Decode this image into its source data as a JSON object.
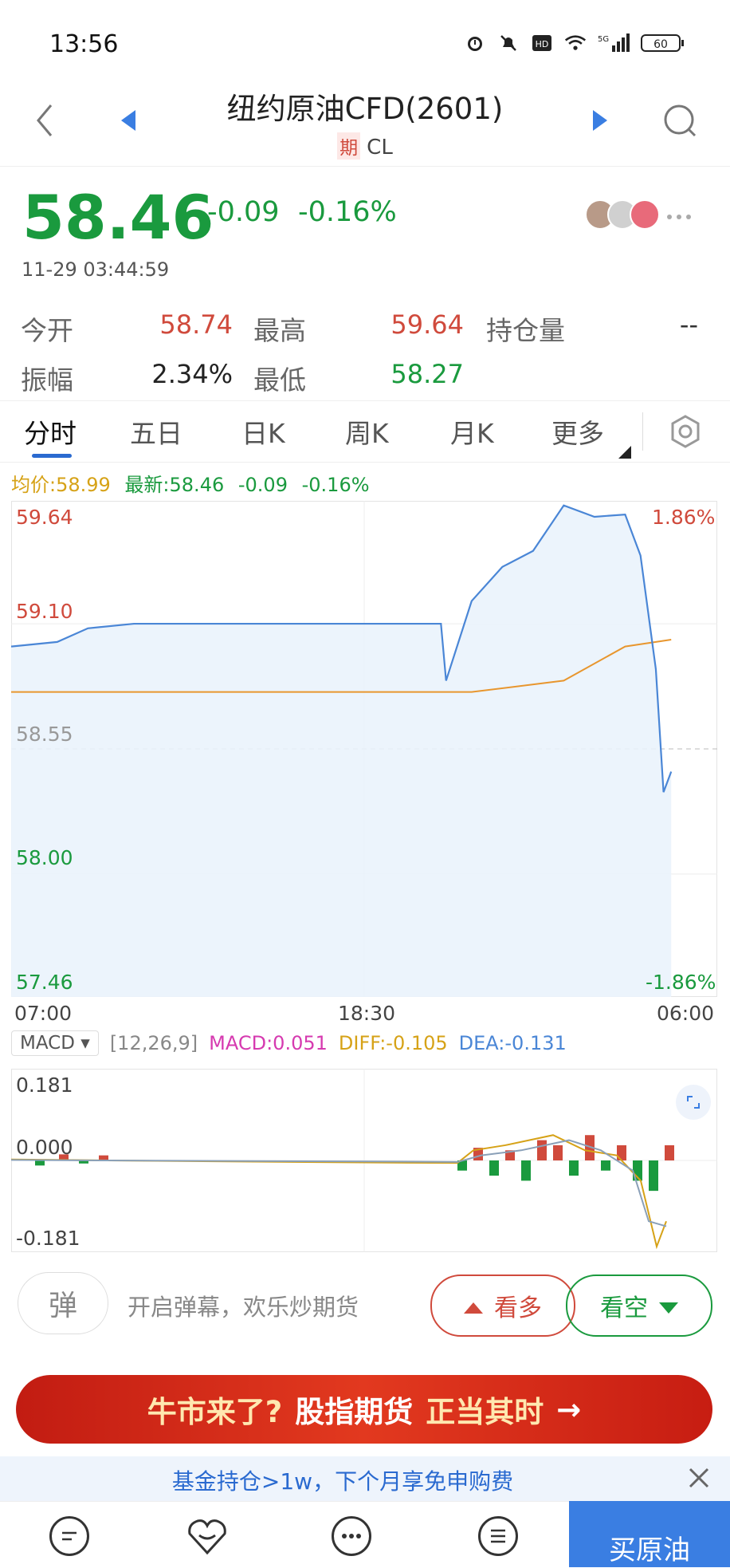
{
  "status": {
    "time": "13:56",
    "battery": "60",
    "signal": "5G"
  },
  "header": {
    "title": "纽约原油CFD(2601)",
    "badge": "期",
    "code": "CL"
  },
  "quote": {
    "price": "58.46",
    "change": "-0.09",
    "change_pct": "-0.16%",
    "timestamp": "11-29 03:44:59"
  },
  "stats": {
    "open_label": "今开",
    "open_value": "58.74",
    "high_label": "最高",
    "high_value": "59.64",
    "oi_label": "持仓量",
    "oi_value": "--",
    "amp_label": "振幅",
    "amp_value": "2.34%",
    "low_label": "最低",
    "low_value": "58.27"
  },
  "tabs": [
    "分时",
    "五日",
    "日K",
    "周K",
    "月K",
    "更多"
  ],
  "legend": {
    "avg": "均价:58.99",
    "latest": "最新:58.46",
    "chg": "-0.09",
    "pct": "-0.16%"
  },
  "chart_data": [
    {
      "type": "line",
      "series": [
        {
          "name": "均价",
          "color": "#e8962e",
          "x": [
            "07:00",
            "11:00",
            "15:00",
            "18:30",
            "22:00",
            "01:00",
            "03:00",
            "04:30"
          ],
          "values": [
            58.8,
            58.8,
            58.8,
            58.8,
            58.8,
            58.85,
            59.0,
            59.03
          ]
        },
        {
          "name": "最新",
          "color": "#4a86d6",
          "x": [
            "07:00",
            "08:30",
            "09:30",
            "11:00",
            "15:00",
            "18:30",
            "21:00",
            "21:10",
            "22:00",
            "23:00",
            "00:00",
            "01:00",
            "02:00",
            "03:00",
            "03:30",
            "04:00",
            "04:15",
            "04:30"
          ],
          "values": [
            59.0,
            59.02,
            59.08,
            59.1,
            59.1,
            59.1,
            59.1,
            58.85,
            59.2,
            59.35,
            59.42,
            59.62,
            59.57,
            59.58,
            59.4,
            58.9,
            58.36,
            58.45
          ]
        }
      ],
      "y_ticks_left": [
        "59.64",
        "59.10",
        "58.55",
        "58.00",
        "57.46"
      ],
      "y_ticks_right": [
        "1.86%",
        "-1.86%"
      ],
      "x_ticks": [
        "07:00",
        "18:30",
        "06:00"
      ],
      "ylim": [
        57.46,
        59.64
      ],
      "reference_line": 58.55
    },
    {
      "type": "bar",
      "title": "MACD",
      "params": "[12,26,9]",
      "macd": "MACD:0.051",
      "diff": "DIFF:-0.105",
      "dea": "DEA:-0.131",
      "y_ticks": [
        "0.181",
        "0.000",
        "-0.181"
      ],
      "ylim": [
        -0.181,
        0.181
      ]
    }
  ],
  "actions": {
    "bullet_icon": "弹",
    "bullet_text": "开启弹幕，欢乐炒期货",
    "bull_label": "看多",
    "bear_label": "看空"
  },
  "banner": {
    "part1": "牛市来了?",
    "part2": "股指期货",
    "part3": "正当其时",
    "arrow": "→"
  },
  "promo": {
    "text": "基金持仓>1w，下个月享免申购费"
  },
  "bottom": {
    "buy_label": "买原油"
  },
  "colors": {
    "up": "#d04a3c",
    "down": "#1a9a3e",
    "accent": "#2a6ad0"
  }
}
